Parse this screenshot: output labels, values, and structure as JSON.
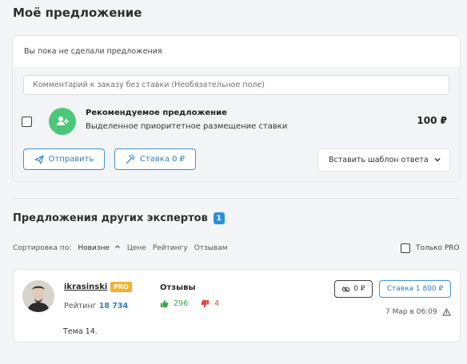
{
  "my_offer": {
    "title": "Моё предложение",
    "empty_text": "Вы пока не сделали предложения",
    "comment_placeholder": "Комментарий к заказу без ставки (Необязательное поле)",
    "recommended": {
      "title": "Рекомендуемое предложение",
      "subtitle": "Выделенное приоритетное размещение ставки",
      "price": "100 ₽",
      "icon": "user-plus-icon",
      "icon_color": "#4cc77a"
    },
    "send_label": "Отправить",
    "bid_label": "Ставка 0 ₽",
    "template_label": "Вставить шаблон ответа"
  },
  "others": {
    "title": "Предложения других экспертов",
    "count": "1",
    "sort_label": "Сортировка по:",
    "sort_options": [
      "Новизне",
      "Цене",
      "Рейтингу",
      "Отзывам"
    ],
    "pro_only_label": "Только PRO",
    "offers": [
      {
        "username": "ikrasinski",
        "badge": "PRO",
        "rating_label": "Рейтинг",
        "rating_value": "18 734",
        "reviews_title": "Отзывы",
        "reviews_positive": "296",
        "reviews_negative": "4",
        "views_label": "0 ₽",
        "bid_label": "Ставка 1 800 ₽",
        "date": "7 Мар в 06:09",
        "topic": "Тема 14."
      }
    ]
  },
  "colors": {
    "accent": "#2d8fd8",
    "success": "#3aa24a",
    "danger": "#e0443d",
    "pro": "#f2b230"
  }
}
